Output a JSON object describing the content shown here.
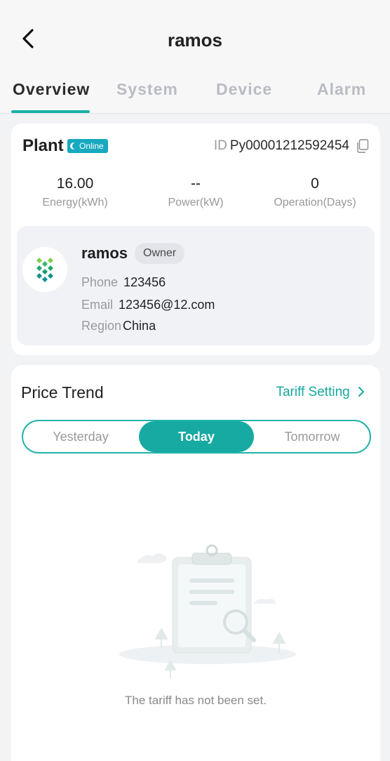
{
  "header": {
    "title": "ramos"
  },
  "tabs": [
    {
      "label": "Overview"
    },
    {
      "label": "System"
    },
    {
      "label": "Device"
    },
    {
      "label": "Alarm"
    }
  ],
  "plant": {
    "label": "Plant",
    "status": "Online",
    "id_prefix": "ID",
    "id_value": "Py00001212592454",
    "stats": [
      {
        "value": "16.00",
        "label": "Energy(kWh)"
      },
      {
        "value": "--",
        "label": "Power(kW)"
      },
      {
        "value": "0",
        "label": "Operation(Days)"
      }
    ],
    "owner": {
      "name": "ramos",
      "role": "Owner",
      "phone_label": "Phone",
      "phone": "123456",
      "email_label": "Email",
      "email": "123456@12.com",
      "region_label": "Region",
      "region": "China"
    }
  },
  "price_trend": {
    "title": "Price Trend",
    "tariff_link": "Tariff Setting",
    "segments": [
      "Yesterday",
      "Today",
      "Tomorrow"
    ],
    "selected": "Today",
    "empty_message": "The tariff has not been set."
  },
  "colors": {
    "accent": "#17aaa2",
    "online_badge": "#16a9bf",
    "background": "#f2f3f5"
  },
  "icons": {
    "back": "chevron-left-icon",
    "copy": "copy-icon",
    "tariff_arrow": "chevron-right-icon",
    "avatar": "plant-logo-icon",
    "empty": "empty-clipboard-illustration"
  }
}
